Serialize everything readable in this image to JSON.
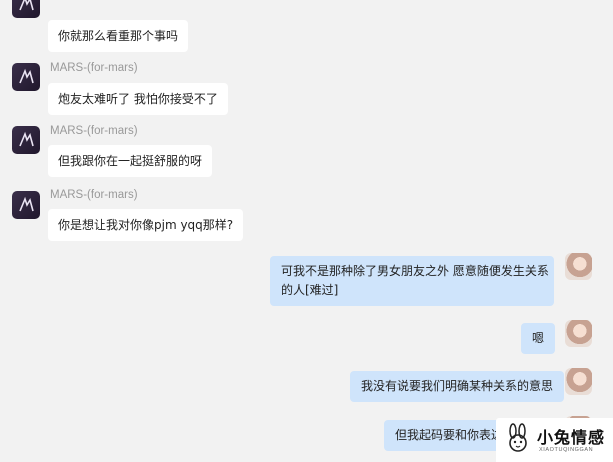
{
  "messages": [
    {
      "side": "left",
      "sender": "",
      "text": "你就那么看重那个事吗"
    },
    {
      "side": "left",
      "sender": "MARS-(for-mars)",
      "text": "炮友太难听了 我怕你接受不了"
    },
    {
      "side": "left",
      "sender": "MARS-(for-mars)",
      "text": "但我跟你在一起挺舒服的呀"
    },
    {
      "side": "left",
      "sender": "MARS-(for-mars)",
      "text": "你是想让我对你像pjm yqq那样?"
    },
    {
      "side": "right",
      "text_line1": "可我不是那种除了男女朋友之外 愿意随便发生关系",
      "text_line2": "的人[难过]"
    },
    {
      "side": "right",
      "text": "嗯"
    },
    {
      "side": "right",
      "text": "我没有说要我们明确某种关系的意思"
    },
    {
      "side": "right",
      "text": "但我起码要和你表达"
    }
  ],
  "watermark": {
    "title": "小兔情感",
    "subtitle": "XIAOTUQINGGAN"
  },
  "colors": {
    "background": "#f2f2f2",
    "bubble_left": "#ffffff",
    "bubble_right": "#cfe4fb",
    "sender_text": "#999999"
  }
}
